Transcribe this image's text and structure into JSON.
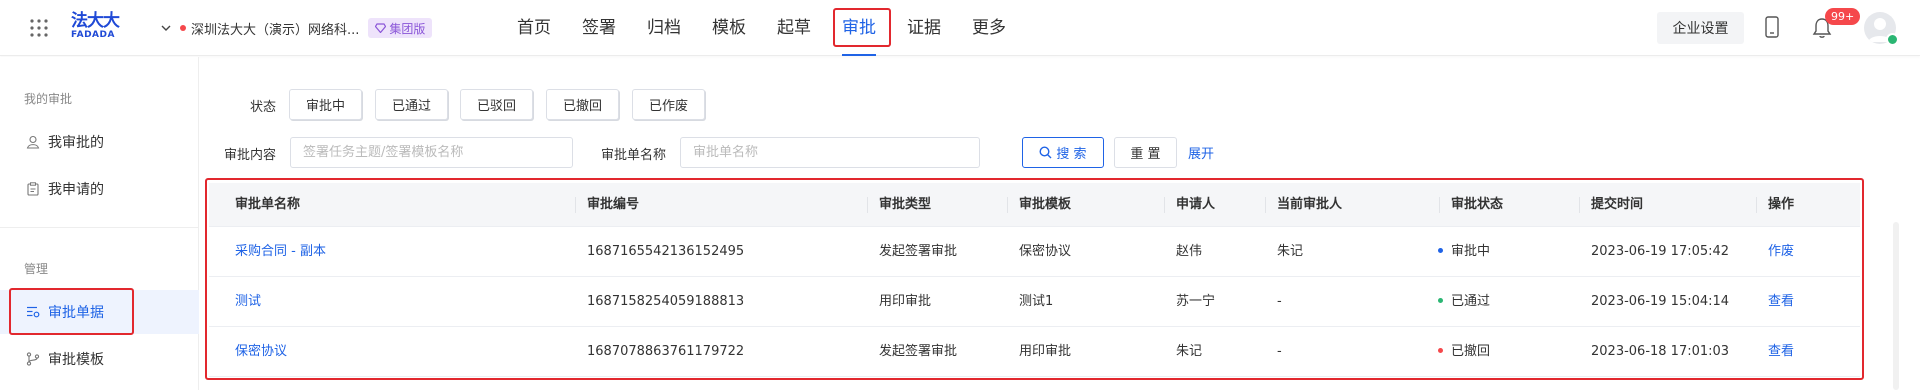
{
  "header": {
    "logo_zh": "法大大",
    "logo_en": "FADADA",
    "org_name": "深圳法大大（演示）网络科...",
    "org_badge": "集团版",
    "nav": [
      "首页",
      "签署",
      "归档",
      "模板",
      "起草",
      "审批",
      "证据",
      "更多"
    ],
    "active_nav": "审批",
    "enterprise_settings": "企业设置",
    "notification_count": "99+",
    "colors": {
      "accent": "#1f63e6",
      "badge_red": "#f5484b",
      "highlight": "#e2282e",
      "group_badge": "#8b56d8"
    }
  },
  "sidebar": {
    "group1": "我的审批",
    "my_approvals": "我审批的",
    "my_requests": "我申请的",
    "group2": "管理",
    "approval_docs": "审批单据",
    "approval_templates": "审批模板"
  },
  "filters": {
    "status_label": "状态",
    "statuses": [
      "审批中",
      "已通过",
      "已驳回",
      "已撤回",
      "已作废"
    ],
    "content_label": "审批内容",
    "content_placeholder": "签署任务主题/签署模板名称",
    "docname_label": "审批单名称",
    "docname_placeholder": "审批单名称",
    "search": "搜 索",
    "reset": "重 置",
    "expand": "展开"
  },
  "table": {
    "columns": [
      "审批单名称",
      "审批编号",
      "审批类型",
      "审批模板",
      "申请人",
      "当前审批人",
      "审批状态",
      "提交时间",
      "操作"
    ],
    "rows": [
      {
        "name": "采购合同 - 副本",
        "number": "1687165542136152495",
        "type": "发起签署审批",
        "template": "保密协议",
        "applicant": "赵伟",
        "approver": "朱记",
        "status": "审批中",
        "status_color": "#1f63e6",
        "time": "2023-06-19 17:05:42",
        "action": "作废"
      },
      {
        "name": "测试",
        "number": "1687158254059188813",
        "type": "用印审批",
        "template": "测试1",
        "applicant": "苏一宁",
        "approver": "-",
        "status": "已通过",
        "status_color": "#2bb673",
        "time": "2023-06-19 15:04:14",
        "action": "查看"
      },
      {
        "name": "保密协议",
        "number": "1687078863761179722",
        "type": "发起签署审批",
        "template": "用印审批",
        "applicant": "朱记",
        "approver": "-",
        "status": "已撤回",
        "status_color": "#f5484b",
        "time": "2023-06-18 17:01:03",
        "action": "查看"
      }
    ]
  }
}
